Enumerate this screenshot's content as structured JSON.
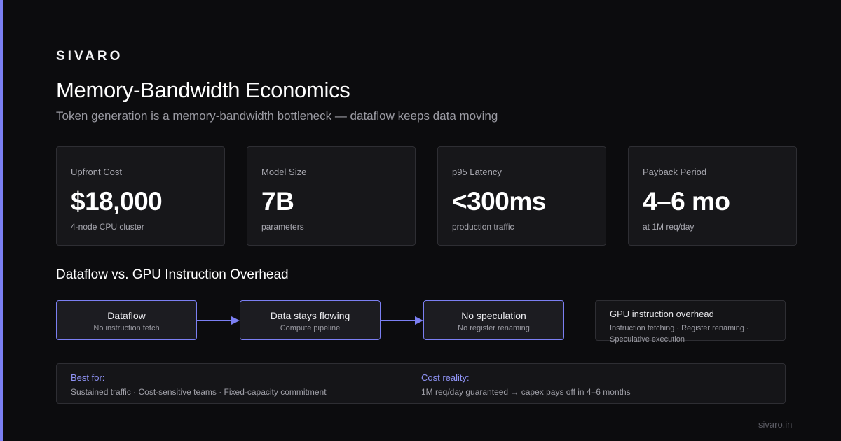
{
  "brand": "SIVARO",
  "title": "Memory-Bandwidth Economics",
  "subtitle": "Token generation is a memory-bandwidth bottleneck — dataflow keeps data moving",
  "metrics": [
    {
      "label": "Upfront Cost",
      "value": "$18,000",
      "note": "4-node CPU cluster"
    },
    {
      "label": "Model Size",
      "value": "7B",
      "note": "parameters"
    },
    {
      "label": "p95 Latency",
      "value": "<300ms",
      "note": "production traffic"
    },
    {
      "label": "Payback Period",
      "value": "4–6 mo",
      "note": "at 1M req/day"
    }
  ],
  "section_title": "Dataflow vs. GPU Instruction Overhead",
  "flow": [
    {
      "title": "Dataflow",
      "sub": "No instruction fetch"
    },
    {
      "title": "Data stays flowing",
      "sub": "Compute pipeline"
    },
    {
      "title": "No speculation",
      "sub": "No register renaming"
    }
  ],
  "gpu": {
    "title": "GPU instruction overhead",
    "sub": "Instruction fetching · Register renaming · Speculative execution"
  },
  "bottom": {
    "best_for_label": "Best for:",
    "best_for_text": "Sustained traffic · Cost-sensitive teams · Fixed-capacity commitment",
    "cost_label": "Cost reality:",
    "cost_text": "1M req/day guaranteed → capex pays off in 4–6 months"
  },
  "footer": "sivaro.in",
  "colors": {
    "accent": "#7b7ff2",
    "background": "#0c0c0e",
    "card": "#17171a",
    "border": "#2e2e33"
  },
  "icons": {
    "flow_arrow": "right-arrow-icon"
  }
}
